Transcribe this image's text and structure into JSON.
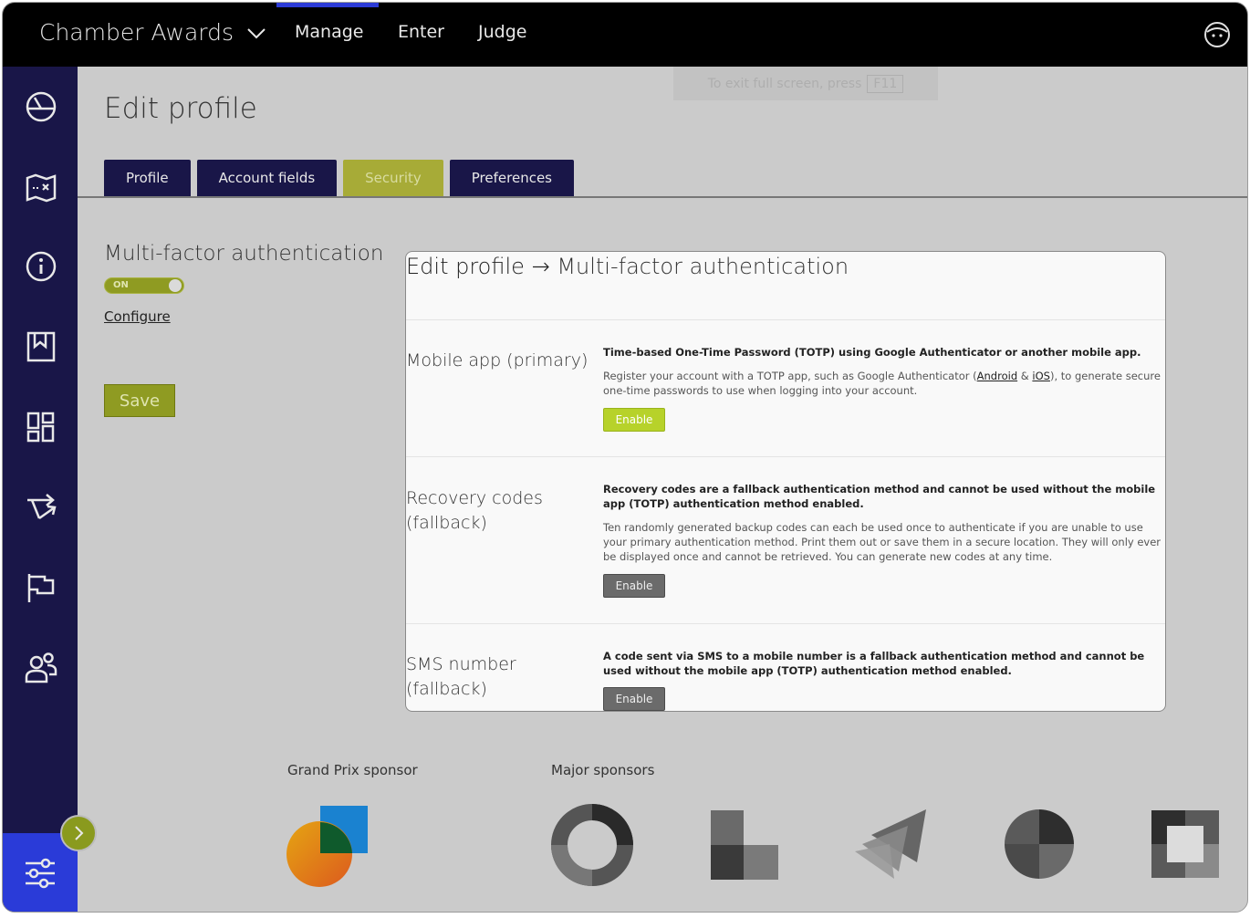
{
  "topbar": {
    "app_title": "Chamber Awards",
    "nav": [
      {
        "label": "Manage"
      },
      {
        "label": "Enter"
      },
      {
        "label": "Judge"
      }
    ]
  },
  "fullscreen_hint": {
    "text": "To exit full screen, press",
    "key": "F11"
  },
  "page": {
    "title": "Edit profile",
    "tabs": [
      {
        "label": "Profile"
      },
      {
        "label": "Account fields"
      },
      {
        "label": "Security"
      },
      {
        "label": "Preferences"
      }
    ],
    "mfa_heading": "Multi-factor authentication",
    "toggle_label": "ON",
    "configure_link": "Configure",
    "save_label": "Save"
  },
  "modal": {
    "title_prefix": "Edit profile",
    "title_arrow": "→",
    "title_suffix": "Multi-factor authentication",
    "sections": [
      {
        "label": "Mobile app (primary)",
        "bold": "Time-based One-Time Password (TOTP) using Google Authenticator or another mobile app.",
        "text_before": "Register your account with a TOTP app, such as Google Authenticator (",
        "link1": "Android",
        "amp": " & ",
        "link2": "iOS",
        "text_after": "), to generate secure one-time passwords to use when logging into your account.",
        "button": "Enable"
      },
      {
        "label": "Recovery codes (fallback)",
        "bold": "Recovery codes are a fallback authentication method and cannot be used without the mobile app (TOTP) authentication method enabled.",
        "text": "Ten randomly generated backup codes can each be used once to authenticate if you are unable to use your primary authentication method. Print them out or save them in a secure location. They will only ever be displayed once and cannot be retrieved. You can generate new codes at any time.",
        "button": "Enable"
      },
      {
        "label": "SMS number (fallback)",
        "bold": "A code sent via SMS to a mobile number is a fallback authentication method and cannot be used without the mobile app (TOTP) authentication method enabled.",
        "button": "Enable"
      }
    ]
  },
  "sponsors": {
    "grand_prix_label": "Grand Prix sponsor",
    "major_label": "Major sponsors"
  },
  "colors": {
    "sidebar": "#191648",
    "accent_olive": "#8f9b22",
    "tab_active": "#a7ab37",
    "enable_primary": "#b7d22a",
    "nav_active_bar": "#2c3bd6"
  }
}
